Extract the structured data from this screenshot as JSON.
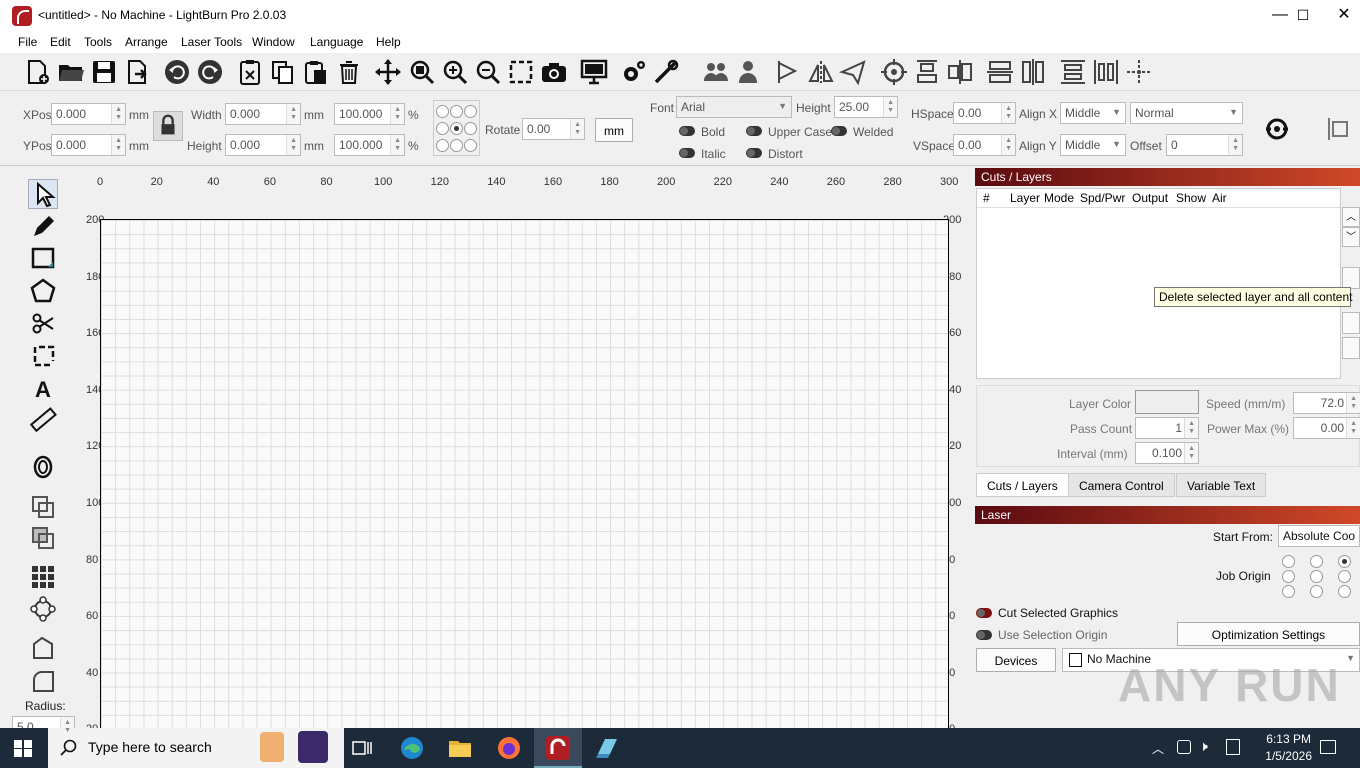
{
  "window": {
    "title": "<untitled> - No Machine - LightBurn Pro 2.0.03",
    "minimize": "—",
    "maximize": "☐",
    "close": "✕"
  },
  "menu": [
    "File",
    "Edit",
    "Tools",
    "Arrange",
    "Laser Tools",
    "Window",
    "Language",
    "Help"
  ],
  "props": {
    "xpos_label": "XPos",
    "xpos": "0.000",
    "ypos_label": "YPos",
    "ypos": "0.000",
    "unit": "mm",
    "width_label": "Width",
    "width": "0.000",
    "height_label": "Height",
    "height": "0.000",
    "wpct": "100.000",
    "hpct": "100.000",
    "pct": "%",
    "rotate_label": "Rotate",
    "rotate": "0.00",
    "units_button": "mm",
    "font_label": "Font",
    "font": "Arial",
    "fheight_label": "Height",
    "fheight": "25.00",
    "bold": "Bold",
    "italic": "Italic",
    "upper": "Upper Case",
    "welded": "Welded",
    "distort": "Distort",
    "hspace_label": "HSpace",
    "hspace": "0.00",
    "vspace_label": "VSpace",
    "vspace": "0.00",
    "alignx_label": "Align X",
    "alignx": "Middle",
    "aligny_label": "Align Y",
    "aligny": "Middle",
    "mode": "Normal",
    "offset_label": "Offset",
    "offset": "0"
  },
  "left": {
    "radius_label": "Radius:",
    "radius": "5.0"
  },
  "ruler": {
    "x": [
      "0",
      "20",
      "40",
      "60",
      "80",
      "100",
      "120",
      "140",
      "160",
      "180",
      "200",
      "220",
      "240",
      "260",
      "280",
      "300"
    ],
    "y": [
      "200",
      "180",
      "160",
      "140",
      "120",
      "100",
      "80",
      "60",
      "40",
      "20"
    ]
  },
  "cuts": {
    "title": "Cuts / Layers",
    "columns": [
      "#",
      "Layer",
      "Mode",
      "Spd/Pwr",
      "Output",
      "Show",
      "Air"
    ],
    "tooltip": "Delete selected layer and all content",
    "layer_color_label": "Layer Color",
    "speed_label": "Speed (mm/m)",
    "speed": "72.0",
    "pass_label": "Pass Count",
    "pass": "1",
    "power_label": "Power Max (%)",
    "power": "0.00",
    "interval_label": "Interval (mm)",
    "interval": "0.100",
    "tabs": [
      "Cuts / Layers",
      "Camera Control",
      "Variable Text"
    ]
  },
  "laser": {
    "title": "Laser",
    "start_from_label": "Start From:",
    "start_from": "Absolute Coo",
    "job_origin_label": "Job Origin",
    "cut_selected": "Cut Selected Graphics",
    "use_origin": "Use Selection Origin",
    "optimization": "Optimization Settings",
    "devices": "Devices",
    "machine": "No Machine"
  },
  "taskbar": {
    "search": "Type here to search",
    "time": "6:13 PM",
    "date": "1/5/2026"
  },
  "watermark": "ANY RUN",
  "colors": {
    "accent": "#b01e23",
    "panel_grad_start": "#5a0a10",
    "panel_grad_end": "#d04828",
    "taskbar": "#1c2a3a"
  }
}
